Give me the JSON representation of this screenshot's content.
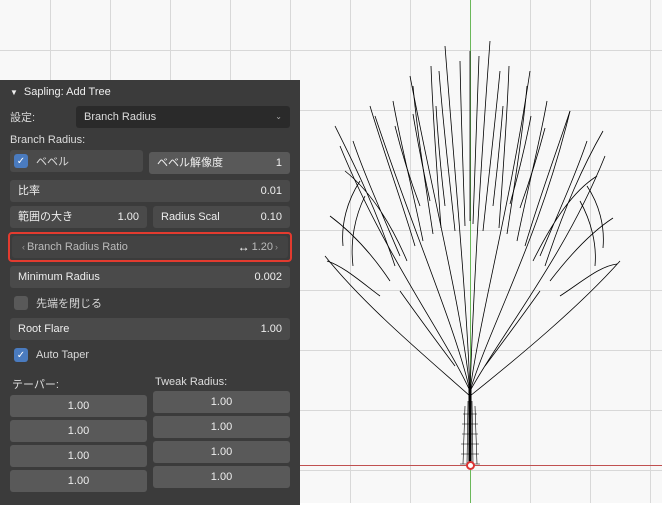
{
  "header": {
    "title": "Sapling: Add Tree"
  },
  "settings": {
    "label": "設定:",
    "selected": "Branch Radius"
  },
  "section_label": "Branch Radius:",
  "bevel": {
    "checkbox_label": "ベベル",
    "resolution_label": "ベベル解像度",
    "resolution_value": "1"
  },
  "ratio": {
    "label": "比率",
    "value": "0.01"
  },
  "radius_scale_range": {
    "label": "範囲の大き",
    "value": "1.00"
  },
  "radius_scale": {
    "label": "Radius Scal",
    "value": "0.10"
  },
  "branch_radius_ratio": {
    "label": "Branch Radius Ratio",
    "value": "1.20"
  },
  "minimum_radius": {
    "label": "Minimum Radius",
    "value": "0.002"
  },
  "close_tip": {
    "label": "先端を閉じる"
  },
  "root_flare": {
    "label": "Root Flare",
    "value": "1.00"
  },
  "auto_taper": {
    "label": "Auto Taper"
  },
  "taper": {
    "header": "テーパー:",
    "values": [
      "1.00",
      "1.00",
      "1.00",
      "1.00"
    ]
  },
  "tweak_radius": {
    "header": "Tweak Radius:",
    "values": [
      "1.00",
      "1.00",
      "1.00",
      "1.00"
    ]
  }
}
